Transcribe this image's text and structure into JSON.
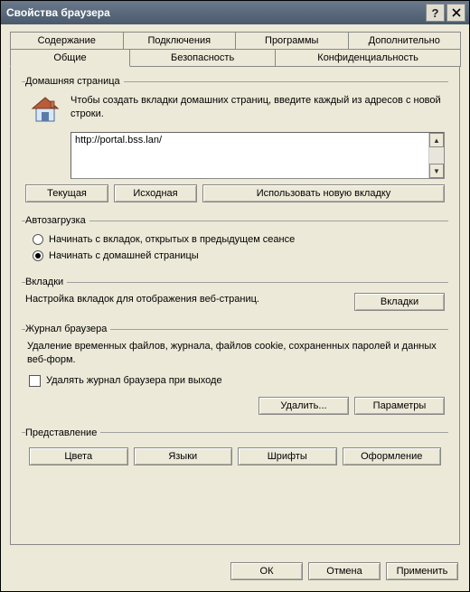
{
  "window": {
    "title": "Свойства браузера"
  },
  "tabs": {
    "row1": [
      "Содержание",
      "Подключения",
      "Программы",
      "Дополнительно"
    ],
    "row2": [
      "Общие",
      "Безопасность",
      "Конфиденциальность"
    ]
  },
  "home": {
    "legend": "Домашняя страница",
    "desc": "Чтобы создать вкладки домашних страниц, введите каждый из адресов с новой строки.",
    "url": "http://portal.bss.lan/",
    "buttons": {
      "current": "Текущая",
      "default": "Исходная",
      "newtab": "Использовать новую вкладку"
    }
  },
  "startup": {
    "legend": "Автозагрузка",
    "opt1": "Начинать с вкладок, открытых в предыдущем сеансе",
    "opt2": "Начинать с домашней страницы"
  },
  "tabsSection": {
    "legend": "Вкладки",
    "desc": "Настройка вкладок для отображения веб-страниц.",
    "button": "Вкладки"
  },
  "history": {
    "legend": "Журнал браузера",
    "desc": "Удаление временных файлов, журнала, файлов cookie, сохраненных паролей и данных веб-форм.",
    "checkbox": "Удалять журнал браузера при выходе",
    "delete": "Удалить...",
    "settings": "Параметры"
  },
  "appearance": {
    "legend": "Представление",
    "colors": "Цвета",
    "languages": "Языки",
    "fonts": "Шрифты",
    "accessibility": "Оформление"
  },
  "bottom": {
    "ok": "ОК",
    "cancel": "Отмена",
    "apply": "Применить"
  }
}
